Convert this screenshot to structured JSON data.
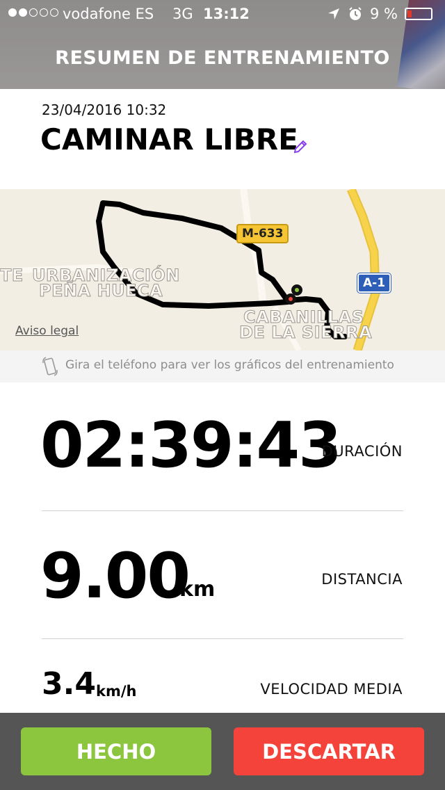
{
  "status_bar": {
    "signal_full": 2,
    "signal_total": 5,
    "carrier": "vodafone ES",
    "network": "3G",
    "time": "13:12",
    "battery_percent": "9 %",
    "battery_level": 0.09,
    "icons": [
      "location-arrow-icon",
      "alarm-clock-icon",
      "battery-icon"
    ]
  },
  "header": {
    "title": "RESUMEN DE ENTRENAMIENTO"
  },
  "workout": {
    "date": "23/04/2016 10:32",
    "name": "CAMINAR LIBRE",
    "edit_icon": "pencil-icon"
  },
  "map": {
    "labels": {
      "place1_line1": "URBANIZACIÓN",
      "place1_line2": "PEÑA HUECA",
      "place2_line1": "CABANILLAS",
      "place2_line2": "DE LA SIERRA",
      "fragment_left": "TE"
    },
    "road_badges": [
      "M-633",
      "A-1"
    ],
    "legal_link": "Aviso legal",
    "colors": {
      "background": "#f3eee4",
      "route": "#000000",
      "highway": "#f6d34a"
    }
  },
  "rotate_hint": {
    "text": "Gira el teléfono para ver los gráficos del entrenamiento",
    "icon": "rotate-phone-icon"
  },
  "stats": {
    "duration": {
      "value": "02:39:43",
      "label": "DURACIÓN"
    },
    "distance": {
      "value": "9.00",
      "unit": "km",
      "label": "DISTANCIA"
    },
    "avg_speed": {
      "value": "3.4",
      "unit": "km/h",
      "label": "VELOCIDAD MEDIA"
    }
  },
  "actions": {
    "done_label": "HECHO",
    "discard_label": "DESCARTAR",
    "colors": {
      "done": "#8cc63f",
      "discard": "#f4433a"
    }
  }
}
